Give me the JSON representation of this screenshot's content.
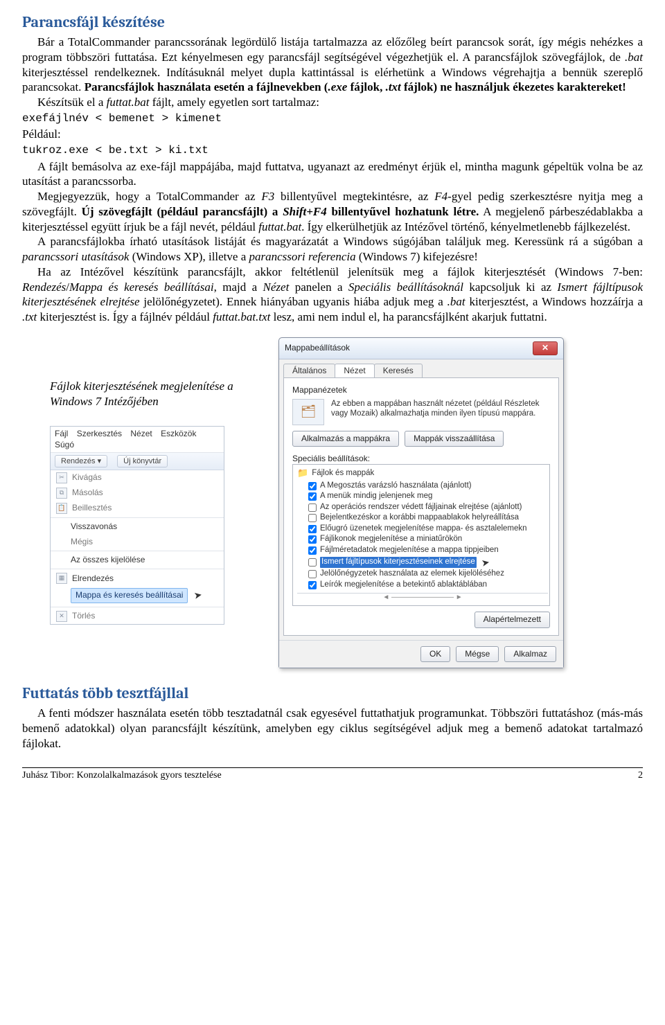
{
  "section1_title": "Parancsfájl készítése",
  "para1_a": "Bár a TotalCommander parancssorának legördülő listája tartalmazza az előzőleg beírt parancsok sorát, így mégis nehézkes a program többszöri futtatása. Ezt kényelmesen egy parancsfájl segítségével végezhetjük el. A parancsfájlok szövegfájlok, de ",
  "para1_bat": ".bat",
  "para1_b": " kiterjesztéssel rendelkeznek. Indításuknál melyet dupla kattintással is elérhetünk a Windows végrehajtja a bennük szereplő parancsokat. ",
  "para1_bold1": "Parancsfájlok használata esetén a fájlnevekben (",
  "para1_exe": ".exe",
  "para1_bold2": " fájlok, ",
  "para1_txt": ".txt",
  "para1_bold3": " fájlok) ne használjuk ékezetes karaktereket!",
  "para2_a": "Készítsük el a ",
  "para2_futtat": "futtat.bat",
  "para2_b": " fájlt, amely egyetlen sort tartalmaz:",
  "code1": "exefájlnév < bemenet > kimenet",
  "peldaul": "Például:",
  "code2": "tukroz.exe < be.txt > ki.txt",
  "para3": "A fájlt bemásolva az exe-fájl mappájába, majd futtatva, ugyanazt az eredményt érjük el, mintha magunk gépeltük volna be az utasítást a parancssorba.",
  "para4_a": "Megjegyezzük, hogy a TotalCommander az ",
  "para4_f3": "F3",
  "para4_b": " billentyűvel megtekintésre, az ",
  "para4_f4": "F4",
  "para4_c": "-gyel pedig szerkesztésre nyitja meg a szövegfájlt. ",
  "para4_bold": "Új szövegfájlt (például parancsfájlt) a ",
  "para4_shift": "Shift+F4",
  "para4_bold2": " billentyűvel hozhatunk létre.",
  "para4_d": " A megjelenő párbeszédablakba a kiterjesztéssel együtt írjuk be a fájl nevét, például ",
  "para4_futtat": "futtat.bat",
  "para4_e": ". Így elkerülhetjük az Intézővel történő, kényelmetlenebb fájlkezelést.",
  "para5_a": "A parancsfájlokba írható utasítások listáját és magyarázatát a Windows súgójában találjuk meg. Keressünk rá a súgóban a ",
  "para5_i1": "parancssori utasítások",
  "para5_b": " (Windows XP), illetve a ",
  "para5_i2": "parancssori referencia",
  "para5_c": " (Windows 7) kifejezésre!",
  "para6_a": "Ha az Intézővel készítünk parancsfájlt, akkor feltétlenül jelenítsük meg a fájlok kiterjesztését (Windows 7-ben: ",
  "para6_i1": "Rendezés",
  "para6_sep": "/",
  "para6_i2": "Mappa és keresés beállításai",
  "para6_b": ", majd a ",
  "para6_i3": "Nézet",
  "para6_c": " panelen a ",
  "para6_i4": "Speciális beállításoknál",
  "para6_d": " kapcsoljuk ki az ",
  "para6_i5": "Ismert fájltípusok kiterjesztésének elrejtése",
  "para6_e": " jelölőnégyzetet). Ennek hiányában ugyanis hiába adjuk meg a ",
  "para6_bat": ".bat",
  "para6_f": " kiterjesztést, a Windows hozzáírja a ",
  "para6_txt": ".txt",
  "para6_g": " kiterjesztést is. Így a fájlnév például ",
  "para6_i6": "futtat.bat.txt",
  "para6_h": " lesz, ami nem indul el, ha parancsfájlként akarjuk futtatni.",
  "figcaption": "Fájlok kiterjesztésének megjelenítése a Windows 7 Intézőjében",
  "explorer": {
    "menu": [
      "Fájl",
      "Szerkesztés",
      "Nézet",
      "Eszközök",
      "Súgó"
    ],
    "toolbar": [
      "Rendezés ▾",
      "Új könyvtár"
    ],
    "items": [
      "Kivágás",
      "Másolás",
      "Beillesztés",
      "Visszavonás",
      "Mégis",
      "Az összes kijelölése",
      "Elrendezés",
      "Mappa és keresés beállításai",
      "Törlés"
    ]
  },
  "dialog": {
    "title": "Mappabeállítások",
    "close": "✕",
    "tabs": [
      "Általános",
      "Nézet",
      "Keresés"
    ],
    "group_title": "Mappanézetek",
    "group_text": "Az ebben a mappában használt nézetet (például Részletek vagy Mozaik) alkalmazhatja minden ilyen típusú mappára.",
    "btn_apply_folder": "Alkalmazás a mappákra",
    "btn_reset_folders": "Mappák visszaállítása",
    "spec_title": "Speciális beállítások:",
    "folder_label": "Fájlok és mappák",
    "options": [
      {
        "label": "A Megosztás varázsló használata (ajánlott)",
        "checked": true
      },
      {
        "label": "A menük mindig jelenjenek meg",
        "checked": true
      },
      {
        "label": "Az operációs rendszer védett fájljainak elrejtése (ajánlott)",
        "checked": false
      },
      {
        "label": "Bejelentkezéskor a korábbi mappaablakok helyreállítása",
        "checked": false
      },
      {
        "label": "Előugró üzenetek megjelenítése mappa- és asztalelemekn",
        "checked": true
      },
      {
        "label": "Fájlikonok megjelenítése a miniatűrökön",
        "checked": true
      },
      {
        "label": "Fájlméretadatok megjelenítése a mappa tippjeiben",
        "checked": true
      },
      {
        "label": "Ismert fájltípusok kiterjesztéseinek elrejtése",
        "checked": false,
        "highlight": true
      },
      {
        "label": "Jelölőnégyzetek használata az elemek kijelöléséhez",
        "checked": false
      },
      {
        "label": "Leírók megjelenítése a betekintő ablaktáblában",
        "checked": true
      }
    ],
    "btn_default": "Alapértelmezett",
    "btn_ok": "OK",
    "btn_cancel": "Mégse",
    "btn_apply": "Alkalmaz"
  },
  "section2_title": "Futtatás több tesztfájllal",
  "para7": "A fenti módszer használata esetén több tesztadatnál csak egyesével futtathatjuk programunkat. Többszöri futtatáshoz (más-más bemenő adatokkal) olyan parancsfájlt készítünk, amelyben egy ciklus segítségével adjuk meg a bemenő adatokat tartalmazó fájlokat.",
  "footer_left": "Juhász Tibor: Konzolalkalmazások gyors tesztelése",
  "footer_right": "2"
}
